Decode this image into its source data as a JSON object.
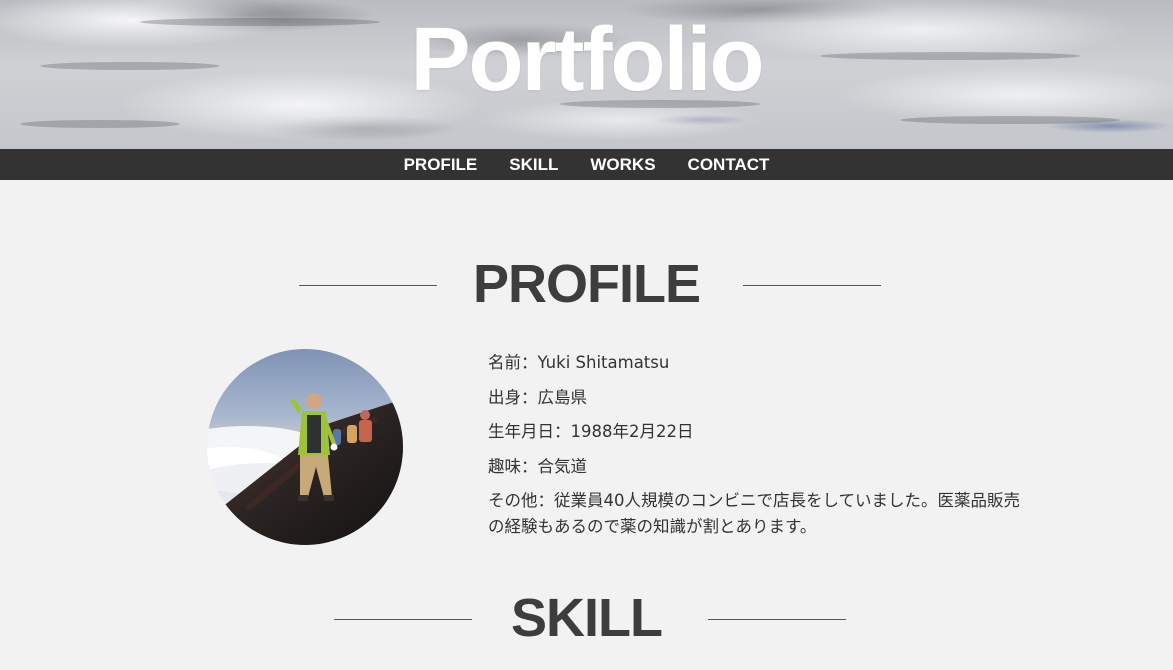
{
  "hero": {
    "title": "Portfolio"
  },
  "nav": {
    "items": [
      "PROFILE",
      "SKILL",
      "WORKS",
      "CONTACT"
    ]
  },
  "profile": {
    "heading": "PROFILE",
    "items": [
      "名前：Yuki Shitamatsu",
      "出身：広島県",
      "生年月日：1988年2月22日",
      "趣味：合気道",
      "その他：従業員40人規模のコンビニで店長をしていました。医薬品販売の経験もあるので薬の知識が割とあります。"
    ]
  },
  "skill": {
    "heading": "SKILL"
  }
}
